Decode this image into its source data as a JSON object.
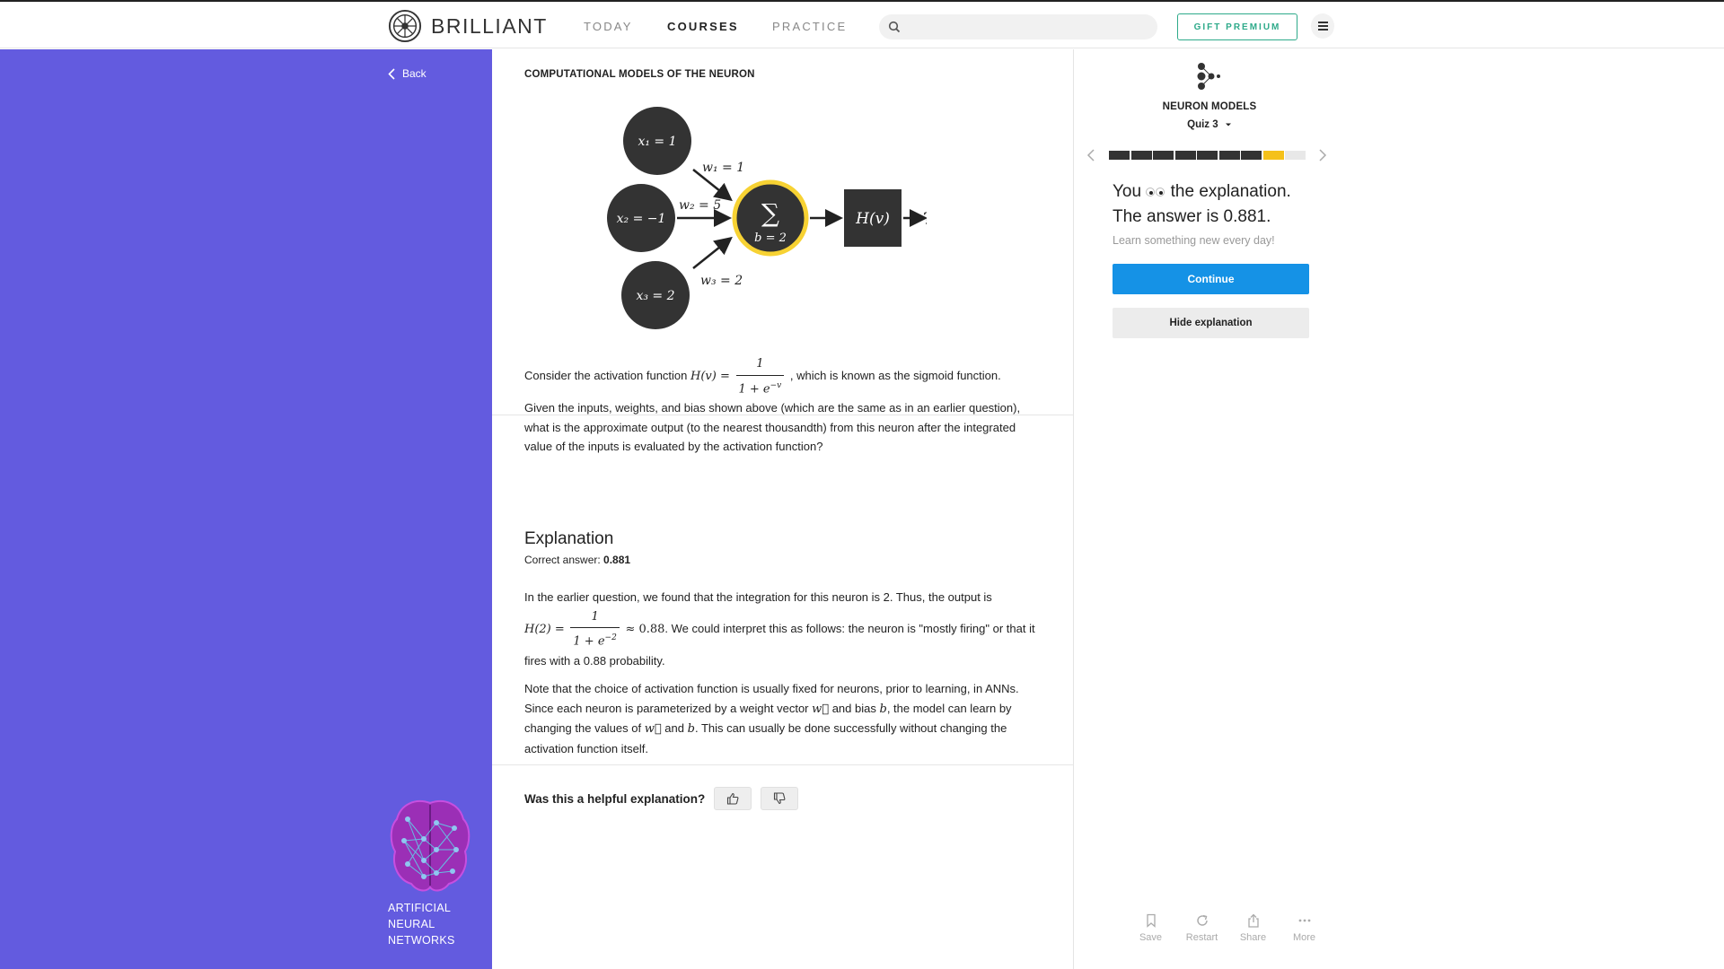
{
  "nav": {
    "logo_text": "BRILLIANT",
    "links": [
      {
        "label": "TODAY"
      },
      {
        "label": "COURSES"
      },
      {
        "label": "PRACTICE"
      }
    ],
    "search_placeholder": "",
    "gift_label": "GIFT PREMIUM",
    "accent_color": "#2eaa8a"
  },
  "sidebar": {
    "back_label": "Back",
    "course_name": "ARTIFICIAL NEURAL NETWORKS",
    "background_color": "#635bdf"
  },
  "main": {
    "chapter_title": "COMPUTATIONAL MODELS OF THE NEURON",
    "diagram": {
      "inputs": [
        "x₁ = 1",
        "x₂ = −1",
        "x₃ = 2"
      ],
      "weights": [
        "w₁ = 1",
        "w₂ = 5",
        "w₃ = 2"
      ],
      "sum_symbol": "∑",
      "bias": "b = 2",
      "activation": "H(v)",
      "output": "?"
    },
    "question": {
      "intro": "Consider the activation function",
      "func_lhs": "H(v) =",
      "func_num": "1",
      "func_den": "1 + e",
      "func_exp": "−v",
      "after_func": ", which is known as the sigmoid function.",
      "body": "Given the inputs, weights, and bias shown above (which are the same as in an earlier question), what is the approximate output (to the nearest thousandth) from this neuron after the integrated value of the inputs is evaluated by the activation function?"
    },
    "explanation": {
      "heading": "Explanation",
      "correct_label": "Correct answer:",
      "correct_value": "0.881",
      "p1_start": "In the earlier question, we found that the integration for this neuron is 2. Thus, the output is",
      "p1_lhs": "H(2) =",
      "p1_num": "1",
      "p1_den": "1 + e",
      "p1_exp": "−2",
      "p1_approx": "≈ 0.88",
      "p1_end": ". We could interpret this as follows: the neuron is \"mostly firing\" or that it fires with a 0.88 probability.",
      "p2_a": "Note that the choice of activation function is usually fixed for neurons, prior to learning, in ANNs. Since each neuron is parameterized by a weight vector",
      "p2_w": "w⃗",
      "p2_b_text": "and bias",
      "p2_b": "b",
      "p2_c": ", the model can learn by changing the values of",
      "p2_and": "and",
      "p2_d": ". This can usually be done successfully without changing the activation function itself."
    },
    "feedback_label": "Was this a helpful explanation?"
  },
  "panel": {
    "quiz_name": "NEURON MODELS",
    "quiz_num": "Quiz 3",
    "progress": {
      "total": 9,
      "done": 7,
      "current": 8
    },
    "progress_colors": {
      "done": "#333333",
      "current": "#f5c11a",
      "todo": "#e8e8e8"
    },
    "result_line1_a": "You",
    "result_line1_b": "the explanation.",
    "result_line2": "The answer is 0.881.",
    "tagline": "Learn something new every day!",
    "continue_label": "Continue",
    "hide_label": "Hide explanation",
    "actions": [
      {
        "label": "Save",
        "icon": "bookmark-icon"
      },
      {
        "label": "Restart",
        "icon": "restart-icon"
      },
      {
        "label": "Share",
        "icon": "share-icon"
      },
      {
        "label": "More",
        "icon": "more-icon"
      }
    ],
    "primary_color": "#1592e6"
  }
}
